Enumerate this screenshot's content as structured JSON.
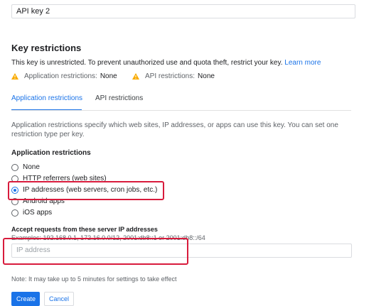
{
  "name_field": {
    "value": "API key 2"
  },
  "key_restrictions": {
    "title": "Key restrictions",
    "warning_text": "This key is unrestricted. To prevent unauthorized use and quota theft, restrict your key.",
    "learn_more": "Learn more",
    "status": [
      {
        "label": "Application restrictions:",
        "value": "None",
        "icon": "warning-icon"
      },
      {
        "label": "API restrictions:",
        "value": "None",
        "icon": "warning-icon"
      }
    ]
  },
  "tabs": [
    {
      "label": "Application restrictions",
      "active": true
    },
    {
      "label": "API restrictions",
      "active": false
    }
  ],
  "description": "Application restrictions specify which web sites, IP addresses, or apps can use this key. You can set one restriction type per key.",
  "restriction_group": {
    "title": "Application restrictions",
    "options": [
      {
        "label": "None",
        "checked": false
      },
      {
        "label": "HTTP referrers (web sites)",
        "checked": false
      },
      {
        "label": "IP addresses (web servers, cron jobs, etc.)",
        "checked": true
      },
      {
        "label": "Android apps",
        "checked": false
      },
      {
        "label": "iOS apps",
        "checked": false
      }
    ]
  },
  "ip_section": {
    "label": "Accept requests from these server IP addresses",
    "examples": "Examples: 192.168.0.1, 172.16.0.0/12, 2001:db8::1 or 2001:db8::/64",
    "placeholder": "IP address"
  },
  "note": "Note: It may take up to 5 minutes for settings to take effect",
  "buttons": {
    "create": "Create",
    "cancel": "Cancel"
  },
  "colors": {
    "accent": "#1a73e8",
    "warning": "#f9ab00",
    "highlight": "#d81b3c"
  }
}
